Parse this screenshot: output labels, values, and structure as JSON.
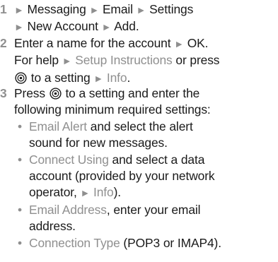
{
  "steps": [
    {
      "number": "1"
    },
    {
      "number": "2"
    },
    {
      "number": "3"
    }
  ],
  "s1": {
    "messaging": "Messaging",
    "email": "Email",
    "settings": "Settings",
    "new_account": "New Account",
    "add": "Add",
    "end": "."
  },
  "s2": {
    "intro": "Enter a name for the account",
    "ok": "OK",
    "period": ".",
    "for_help": "For help",
    "setup_instructions": "Setup Instructions",
    "or_press": " or press",
    "to_a_setting": "to a setting",
    "info": "Info",
    "end": "."
  },
  "s3": {
    "press": "Press",
    "rest_line1": "to a setting and enter the",
    "line2": "following minimum required settings:",
    "bullets": [
      {
        "term": "Email Alert",
        "text_l1": " and select the alert",
        "text_l2": "sound for new messages."
      },
      {
        "term": "Connect Using",
        "text_l1": " and select a data",
        "text_l2": "account (provided by your network",
        "text_l3": "operator, ",
        "info": "Info",
        "close": ")."
      },
      {
        "term": "Email Address",
        "text_l1": ", enter your email",
        "text_l2": "address."
      },
      {
        "term": "Connection Type",
        "text_l1": " (POP3 or IMAP4)."
      }
    ]
  },
  "icons": {
    "arrow": "►",
    "bullet": "•",
    "nav_key": "navigation-key-icon"
  },
  "colors": {
    "text": "#1a1a1a",
    "highlight": "#8f8f8f"
  }
}
